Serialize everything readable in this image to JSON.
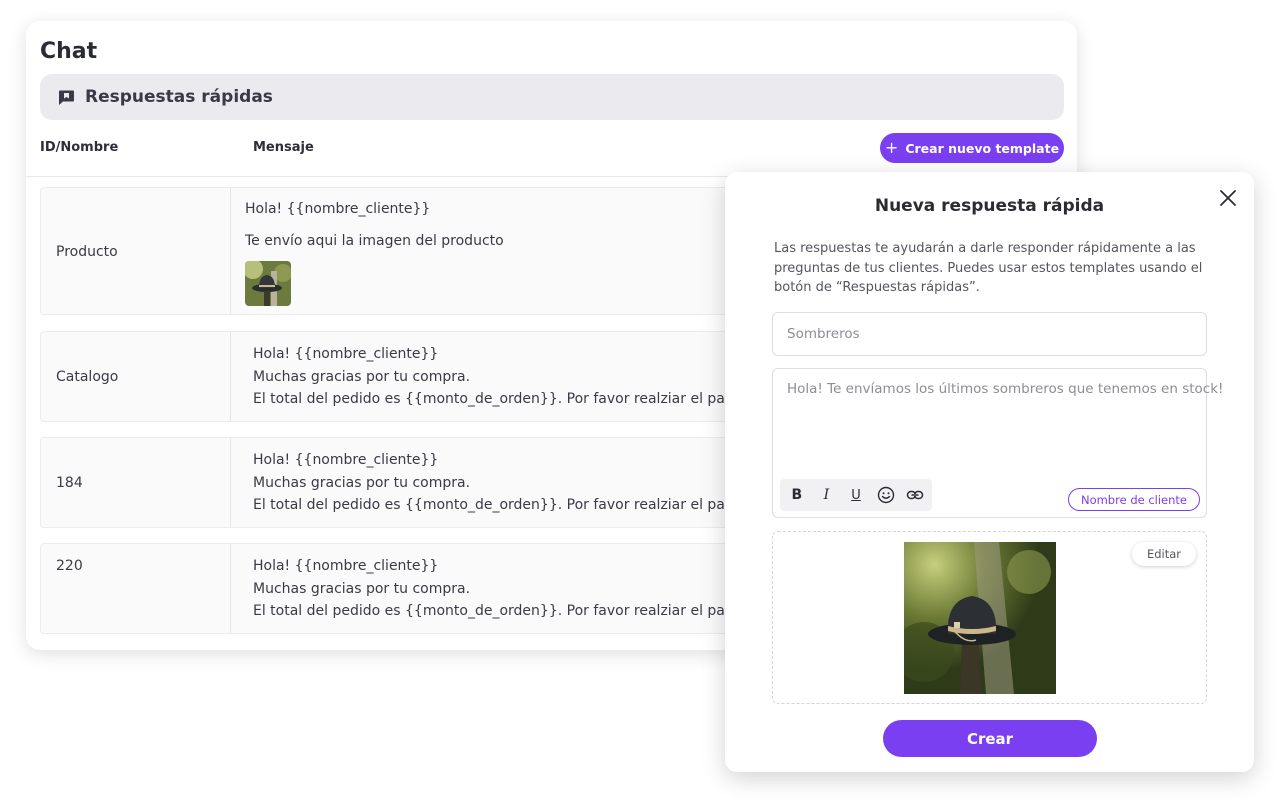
{
  "app": {
    "title": "Chat",
    "section_label": "Respuestas rápidas",
    "columns": {
      "id": "ID/Nombre",
      "message": "Mensaje"
    },
    "create_button": "Crear nuevo template",
    "accent_color": "#7b3ff2"
  },
  "rows": [
    {
      "name": "Producto",
      "lines": [
        "Hola! {{nombre_cliente}}",
        "Te envío aqui la imagen del producto"
      ],
      "has_image": true
    },
    {
      "name": "Catalogo",
      "lines": [
        "Hola! {{nombre_cliente}}",
        "Muchas gracias por tu compra.",
        "El total del pedido es {{monto_de_orden}}. Por favor realziar el pago…"
      ]
    },
    {
      "name": "184",
      "lines": [
        "Hola! {{nombre_cliente}}",
        "Muchas gracias por tu compra.",
        "El total del pedido es {{monto_de_orden}}. Por favor realziar el pago…"
      ]
    },
    {
      "name": "220",
      "lines": [
        "Hola! {{nombre_cliente}}",
        "Muchas gracias por tu compra.",
        "El total del pedido es {{monto_de_orden}}. Por favor realziar el pago…"
      ]
    }
  ],
  "modal": {
    "title": "Nueva respuesta rápida",
    "description": "Las respuestas te ayudarán a darle responder rápidamente a las preguntas de tus clientes. Puedes usar estos templates usando el botón de “Respuestas rápidas”.",
    "name_placeholder": "Sombreros",
    "message_text": "Hola! Te envíamos los últimos sombreros que tenemos en stock!",
    "toolbar": {
      "bold": "B",
      "italic": "I",
      "underline": "U"
    },
    "variable_chip": "Nombre de cliente",
    "edit_label": "Editar",
    "submit_label": "Crear"
  }
}
